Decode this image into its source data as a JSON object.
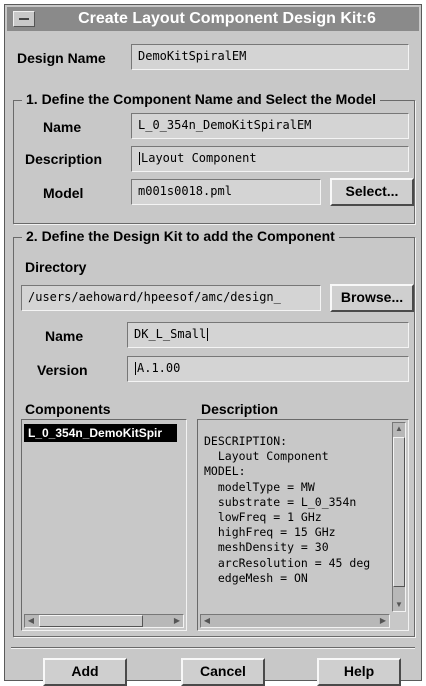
{
  "window": {
    "title": "Create Layout Component Design Kit:6"
  },
  "design_name": {
    "label": "Design Name",
    "value": "DemoKitSpiralEM"
  },
  "section1": {
    "legend": "1. Define the Component Name and Select the Model",
    "name_label": "Name",
    "name_value": "L_0_354n_DemoKitSpiralEM",
    "description_label": "Description",
    "description_value": "Layout Component",
    "model_label": "Model",
    "model_value": "m001s0018.pml",
    "select_button": "Select..."
  },
  "section2": {
    "legend": "2. Define the Design Kit to add the Component",
    "directory_label": "Directory",
    "directory_value": "/users/aehoward/hpeesof/amc/design_",
    "browse_button": "Browse...",
    "name_label": "Name",
    "name_value": "DK_L_Small",
    "version_label": "Version",
    "version_value": "A.1.00",
    "components_label": "Components",
    "components_items": [
      "L_0_354n_DemoKitSpir"
    ],
    "description_label": "Description",
    "description_text": "DESCRIPTION:\n  Layout Component\nMODEL:\n  modelType = MW\n  substrate = L_0_354n\n  lowFreq = 1 GHz\n  highFreq = 15 GHz\n  meshDensity = 30\n  arcResolution = 45 deg\n  edgeMesh = ON"
  },
  "footer": {
    "add_button": "Add",
    "cancel_button": "Cancel",
    "help_button": "Help"
  }
}
